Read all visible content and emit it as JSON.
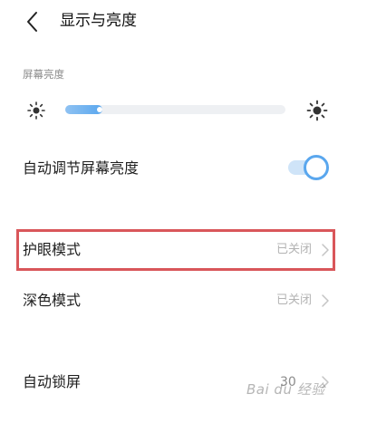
{
  "header": {
    "title": "显示与亮度"
  },
  "brightness": {
    "section_label": "屏幕亮度",
    "level": 0.17
  },
  "auto_brightness": {
    "label": "自动调节屏幕亮度",
    "enabled": true
  },
  "eye_care": {
    "label": "护眼模式",
    "value": "已关闭"
  },
  "dark_mode": {
    "label": "深色模式",
    "value": "已关闭"
  },
  "auto_lock": {
    "label": "自动锁屏",
    "value": "30"
  },
  "watermark": "Bai du 经验",
  "colors": {
    "accent": "#5aa7ee",
    "highlight_border": "#d9565a"
  },
  "icons": [
    "back-arrow-icon",
    "sun-small-icon",
    "sun-large-icon",
    "chevron-right-icon"
  ]
}
